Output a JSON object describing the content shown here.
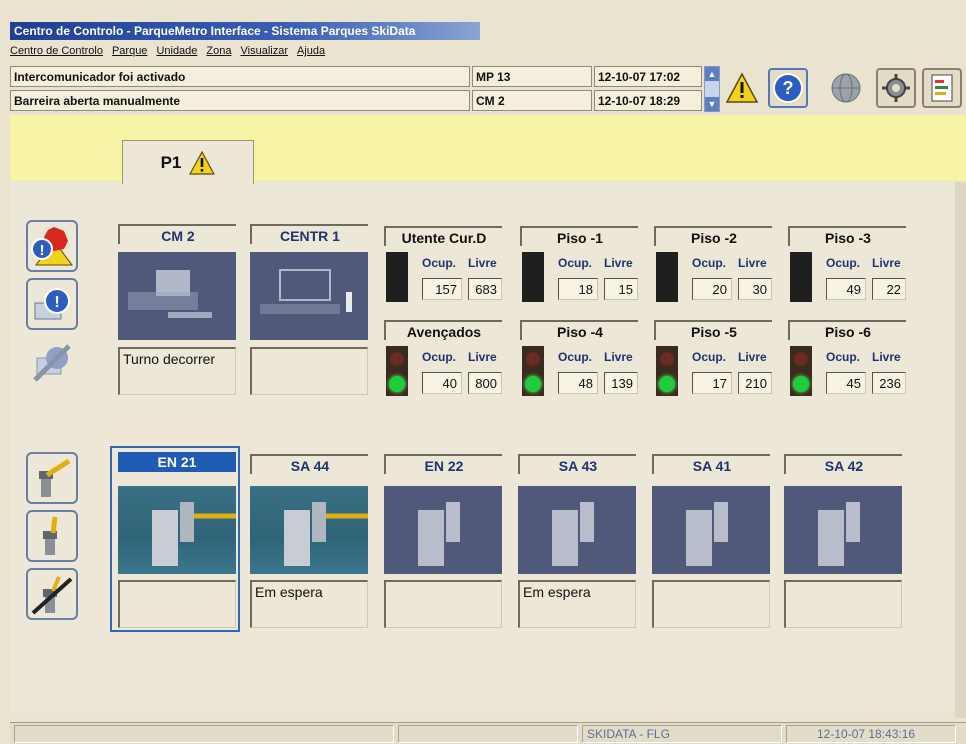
{
  "window": {
    "title": "Centro de Controlo - ParqueMetro Interface - Sistema Parques SkiData"
  },
  "menu": [
    "Centro de Controlo",
    "Parque",
    "Unidade",
    "Zona",
    "Visualizar",
    "Ajuda"
  ],
  "alarms": [
    {
      "message": "Intercomunicador foi activado",
      "device": "MP 13",
      "datetime": "12-10-07 17:02"
    },
    {
      "message": "Barreira aberta manualmente",
      "device": "CM 2",
      "datetime": "12-10-07 18:29"
    }
  ],
  "toolbar": {
    "icons": [
      "warning-icon",
      "help-icon",
      "globe-icon",
      "settings-icon",
      "report-icon"
    ]
  },
  "tab": {
    "label": "P1"
  },
  "cameras": [
    {
      "title": "CM 2",
      "note": "Turno decorrer"
    },
    {
      "title": "CENTR 1",
      "note": ""
    }
  ],
  "counters": [
    {
      "title": "Utente Cur.D",
      "occ_label": "Ocup.",
      "free_label": "Livre",
      "occupied": "157",
      "free": "683",
      "light": "off"
    },
    {
      "title": "Piso -1",
      "occ_label": "Ocup.",
      "free_label": "Livre",
      "occupied": "18",
      "free": "15",
      "light": "off"
    },
    {
      "title": "Piso -2",
      "occ_label": "Ocup.",
      "free_label": "Livre",
      "occupied": "20",
      "free": "30",
      "light": "off"
    },
    {
      "title": "Piso -3",
      "occ_label": "Ocup.",
      "free_label": "Livre",
      "occupied": "49",
      "free": "22",
      "light": "off"
    },
    {
      "title": "Avençados",
      "occ_label": "Ocup.",
      "free_label": "Livre",
      "occupied": "40",
      "free": "800",
      "light": "green"
    },
    {
      "title": "Piso -4",
      "occ_label": "Ocup.",
      "free_label": "Livre",
      "occupied": "48",
      "free": "139",
      "light": "green"
    },
    {
      "title": "Piso -5",
      "occ_label": "Ocup.",
      "free_label": "Livre",
      "occupied": "17",
      "free": "210",
      "light": "green"
    },
    {
      "title": "Piso -6",
      "occ_label": "Ocup.",
      "free_label": "Livre",
      "occupied": "45",
      "free": "236",
      "light": "green"
    }
  ],
  "barriers": [
    {
      "title": "EN 21",
      "note": "",
      "selected": true
    },
    {
      "title": "SA 44",
      "note": "Em espera"
    },
    {
      "title": "EN 22",
      "note": ""
    },
    {
      "title": "SA 43",
      "note": "Em espera"
    },
    {
      "title": "SA 41",
      "note": ""
    },
    {
      "title": "SA 42",
      "note": ""
    }
  ],
  "status_bar": {
    "system": "SKIDATA - FLG",
    "datetime": "12-10-07 18:43:16"
  },
  "colors": {
    "accent": "#1f5bb3",
    "header_text": "#1f3370",
    "band": "#f7f4a5",
    "background": "#ece7d6"
  }
}
